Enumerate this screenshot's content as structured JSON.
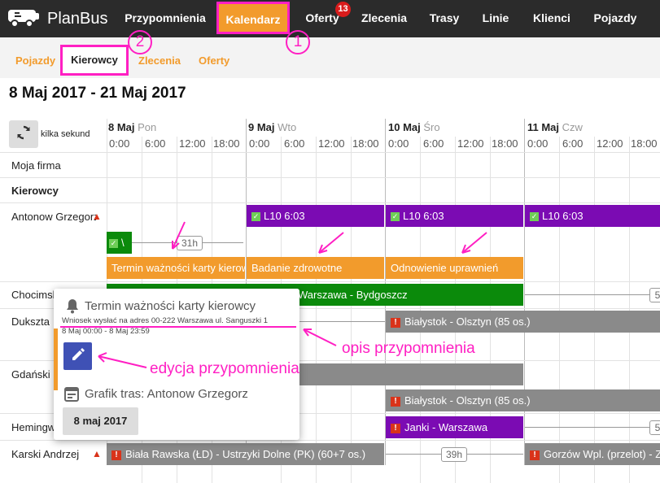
{
  "app": {
    "name": "PlanBus"
  },
  "topnav": [
    {
      "label": "Przypomnienia"
    },
    {
      "label": "Kalendarz"
    },
    {
      "label": "Oferty",
      "badge": "13"
    },
    {
      "label": "Zlecenia"
    },
    {
      "label": "Trasy"
    },
    {
      "label": "Linie"
    },
    {
      "label": "Klienci"
    },
    {
      "label": "Pojazdy"
    }
  ],
  "subnav": [
    {
      "label": "Pojazdy"
    },
    {
      "label": "Kierowcy"
    },
    {
      "label": "Zlecenia"
    },
    {
      "label": "Oferty"
    }
  ],
  "page": {
    "title": "8 Maj 2017 - 21 Maj 2017"
  },
  "toolbar": {
    "refresh_label": "kilka sekund"
  },
  "days": [
    {
      "date": "8 Maj",
      "dow": "Pon"
    },
    {
      "date": "9 Maj",
      "dow": "Wto"
    },
    {
      "date": "10 Maj",
      "dow": "Śro"
    },
    {
      "date": "11 Maj",
      "dow": "Czw"
    }
  ],
  "hours": [
    "0:00",
    "6:00",
    "12:00",
    "18:00"
  ],
  "rows": [
    {
      "label": "Moja firma"
    },
    {
      "label": "Kierowcy",
      "group": true
    },
    {
      "label": "Antonow Grzegorz"
    },
    {
      "label": "Chocimski"
    },
    {
      "label": "Dukszta"
    },
    {
      "label": "Gdański"
    },
    {
      "label": "Hemingway"
    },
    {
      "label": "Karski Andrzej"
    }
  ],
  "events": {
    "l10_1": "L10 6:03",
    "l10_2": "L10 6:03",
    "l10_3": "L10 6:03",
    "green_small": "\\",
    "gap_31h": "31h",
    "rem_1": "Termin ważności karty kierowcy",
    "rem_2": "Badanie zdrowotne",
    "rem_3": "Odnowienie uprawnień",
    "green_long": "Warszawa - Bydgoszcz",
    "gap_5_a": "5",
    "bialystok_1": "Białystok - Olsztyn (85 os.)",
    "bialystok_2": "Białystok - Olsztyn (85 os.)",
    "janki": "Janki - Warszawa",
    "gap_5_b": "5",
    "biala": "Biała Rawska (ŁD) - Ustrzyki Dolne (PK) (60+7 os.)",
    "gap_39h": "39h",
    "gorzow": "Gorzów Wpl. (przelot) - Zi"
  },
  "popover": {
    "title": "Termin ważności karty kierowcy",
    "description": "Wniosek wysłać na adres 00-222 Warszawa ul. Sanguszki 1",
    "daterange": "8 Maj 00:00 - 8 Maj 23:59",
    "schedule_title": "Grafik tras: Antonow Grzegorz",
    "date_button": "8 maj 2017"
  },
  "annotations": {
    "num1": "1",
    "num2": "2",
    "desc": "opis przypomnienia",
    "edit": "edycja przypomnienia"
  },
  "colors": {
    "accent": "#f29b2c",
    "highlight": "#ff1fc3",
    "purple": "#7b0bb3",
    "green": "#0b8a0b",
    "gray": "#8a8a8a",
    "edit_button": "#3f51b5"
  }
}
